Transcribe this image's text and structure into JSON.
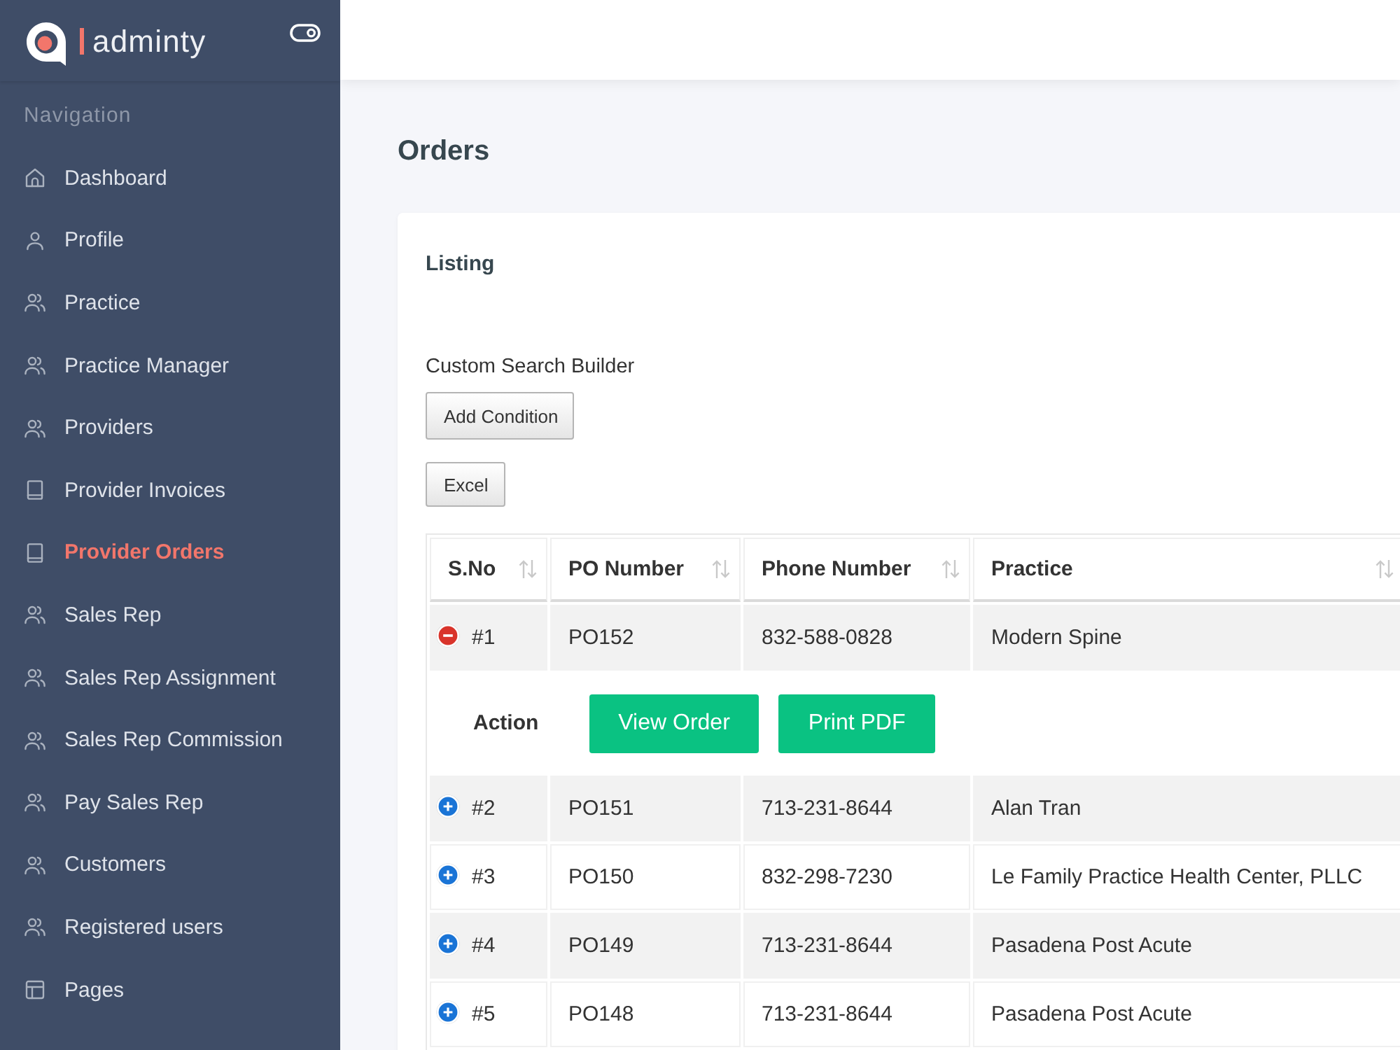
{
  "sidebar": {
    "brand": "adminty",
    "section_label": "Navigation",
    "items": [
      {
        "label": "Dashboard",
        "kind": "home",
        "selected": false
      },
      {
        "label": "Profile",
        "kind": "user",
        "selected": false
      },
      {
        "label": "Practice",
        "kind": "users",
        "selected": false
      },
      {
        "label": "Practice Manager",
        "kind": "users",
        "selected": false
      },
      {
        "label": "Providers",
        "kind": "users",
        "selected": false
      },
      {
        "label": "Provider Invoices",
        "kind": "book",
        "selected": false
      },
      {
        "label": "Provider Orders",
        "kind": "book",
        "selected": true
      },
      {
        "label": "Sales Rep",
        "kind": "users",
        "selected": false
      },
      {
        "label": "Sales Rep Assignment",
        "kind": "users",
        "selected": false
      },
      {
        "label": "Sales Rep Commission",
        "kind": "users",
        "selected": false
      },
      {
        "label": "Pay Sales Rep",
        "kind": "users",
        "selected": false
      },
      {
        "label": "Customers",
        "kind": "users",
        "selected": false
      },
      {
        "label": "Registered users",
        "kind": "users",
        "selected": false
      },
      {
        "label": "Pages",
        "kind": "layout",
        "selected": false
      }
    ]
  },
  "page": {
    "title": "Orders"
  },
  "card": {
    "title": "Listing",
    "search_builder": {
      "label": "Custom Search Builder",
      "button": "Add Condition"
    },
    "export_buttons": [
      "Excel"
    ],
    "table": {
      "columns": [
        "S.No",
        "PO Number",
        "Phone Number",
        "Practice"
      ],
      "rows": [
        {
          "cells": [
            "#1",
            "PO152",
            "832-588-0828",
            "Modern Spine"
          ],
          "expanded": true,
          "details": {
            "label": "Action",
            "buttons": [
              "View Order",
              "Print PDF"
            ]
          }
        },
        {
          "cells": [
            "#2",
            "PO151",
            "713-231-8644",
            "Alan Tran"
          ],
          "expanded": false
        },
        {
          "cells": [
            "#3",
            "PO150",
            "832-298-7230",
            "Le Family Practice Health Center, PLLC"
          ],
          "expanded": false
        },
        {
          "cells": [
            "#4",
            "PO149",
            "713-231-8644",
            "Pasadena Post Acute"
          ],
          "expanded": false
        },
        {
          "cells": [
            "#5",
            "PO148",
            "713-231-8644",
            "Pasadena Post Acute"
          ],
          "expanded": false
        }
      ]
    }
  }
}
